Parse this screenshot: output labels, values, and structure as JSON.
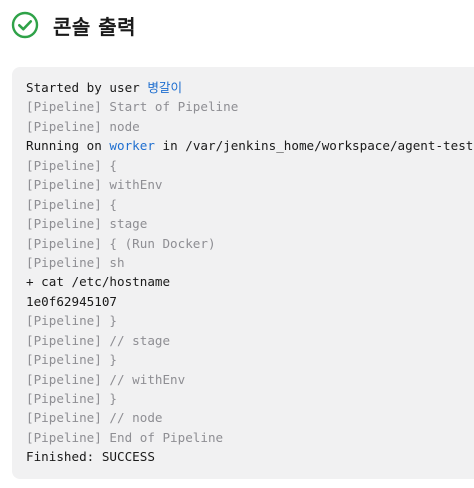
{
  "header": {
    "title": "콘솔 출력",
    "status_icon": "check-circle-icon",
    "status_color": "#2fa248"
  },
  "console": {
    "lines": [
      {
        "kind": "normal",
        "parts": [
          {
            "text": "Started by user "
          },
          {
            "text": "병갈이",
            "link": true
          }
        ]
      },
      {
        "kind": "pipeline",
        "parts": [
          {
            "text": "[Pipeline] Start of Pipeline"
          }
        ]
      },
      {
        "kind": "pipeline",
        "parts": [
          {
            "text": "[Pipeline] node"
          }
        ]
      },
      {
        "kind": "normal",
        "parts": [
          {
            "text": "Running on "
          },
          {
            "text": "worker",
            "link": true
          },
          {
            "text": " in /var/jenkins_home/workspace/agent-test"
          }
        ]
      },
      {
        "kind": "pipeline",
        "parts": [
          {
            "text": "[Pipeline] {"
          }
        ]
      },
      {
        "kind": "pipeline",
        "parts": [
          {
            "text": "[Pipeline] withEnv"
          }
        ]
      },
      {
        "kind": "pipeline",
        "parts": [
          {
            "text": "[Pipeline] {"
          }
        ]
      },
      {
        "kind": "pipeline",
        "parts": [
          {
            "text": "[Pipeline] stage"
          }
        ]
      },
      {
        "kind": "pipeline",
        "parts": [
          {
            "text": "[Pipeline] { (Run Docker)"
          }
        ]
      },
      {
        "kind": "pipeline",
        "parts": [
          {
            "text": "[Pipeline] sh"
          }
        ]
      },
      {
        "kind": "normal",
        "parts": [
          {
            "text": "+ cat /etc/hostname"
          }
        ]
      },
      {
        "kind": "normal",
        "parts": [
          {
            "text": "1e0f62945107"
          }
        ]
      },
      {
        "kind": "pipeline",
        "parts": [
          {
            "text": "[Pipeline] }"
          }
        ]
      },
      {
        "kind": "pipeline",
        "parts": [
          {
            "text": "[Pipeline] // stage"
          }
        ]
      },
      {
        "kind": "pipeline",
        "parts": [
          {
            "text": "[Pipeline] }"
          }
        ]
      },
      {
        "kind": "pipeline",
        "parts": [
          {
            "text": "[Pipeline] // withEnv"
          }
        ]
      },
      {
        "kind": "pipeline",
        "parts": [
          {
            "text": "[Pipeline] }"
          }
        ]
      },
      {
        "kind": "pipeline",
        "parts": [
          {
            "text": "[Pipeline] // node"
          }
        ]
      },
      {
        "kind": "pipeline",
        "parts": [
          {
            "text": "[Pipeline] End of Pipeline"
          }
        ]
      },
      {
        "kind": "normal",
        "parts": [
          {
            "text": "Finished: SUCCESS"
          }
        ]
      }
    ],
    "colors": {
      "text": "#1a1a1a",
      "pipeline": "#8e8e93",
      "link": "#1f6fd0",
      "background": "#f1f1f2"
    }
  }
}
